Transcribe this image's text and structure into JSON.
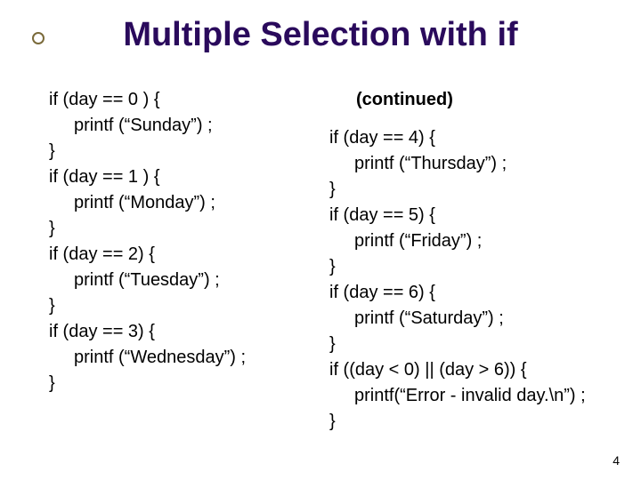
{
  "title": "Multiple Selection with if",
  "left": {
    "l1": "if (day == 0 ) {",
    "l2": "printf (“Sunday”) ;",
    "l3": "}",
    "l4": "if (day == 1 ) {",
    "l5": "printf (“Monday”) ;",
    "l6": "}",
    "l7": "if (day == 2) {",
    "l8": "printf (“Tuesday”) ;",
    "l9": "}",
    "l10": "if (day == 3) {",
    "l11": "printf (“Wednesday”) ;",
    "l12": "}"
  },
  "right": {
    "continued": "(continued)",
    "l1": "if (day == 4) {",
    "l2": "printf (“Thursday”) ;",
    "l3": "}",
    "l4": "if (day == 5) {",
    "l5": "printf (“Friday”) ;",
    "l6": "}",
    "l7": "if (day == 6) {",
    "l8": "printf (“Saturday”) ;",
    "l9": "}",
    "l10": "if ((day < 0) || (day > 6)) {",
    "l11": "printf(“Error - invalid day.\\n”) ;",
    "l12": "}"
  },
  "page_number": "4"
}
